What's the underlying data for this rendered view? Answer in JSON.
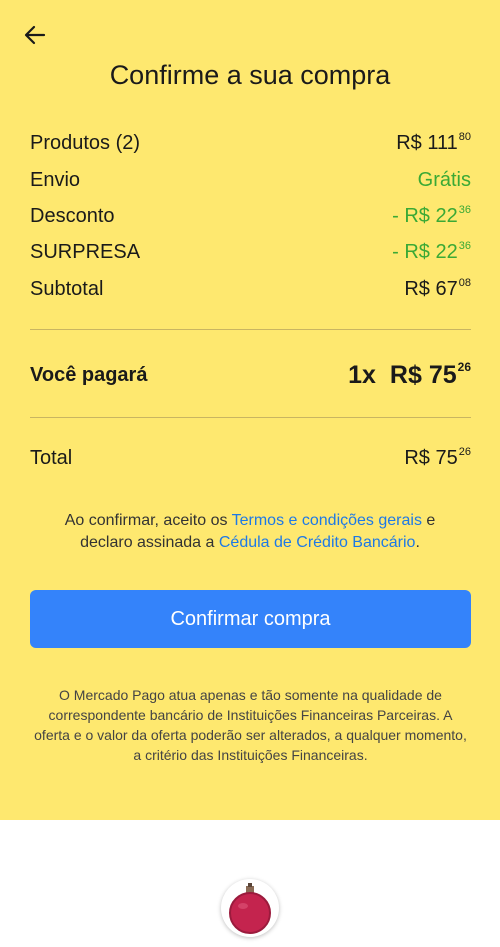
{
  "header": {
    "title": "Confirme a sua compra"
  },
  "summary": {
    "products": {
      "label": "Produtos (2)",
      "currency": "R$",
      "int": "111",
      "cents": "80"
    },
    "shipping": {
      "label": "Envio",
      "value": "Grátis"
    },
    "discount": {
      "label": "Desconto",
      "prefix": "- R$",
      "int": "22",
      "cents": "36"
    },
    "surprise": {
      "label": "SURPRESA",
      "prefix": "- R$",
      "int": "22",
      "cents": "36"
    },
    "subtotal": {
      "label": "Subtotal",
      "currency": "R$",
      "int": "67",
      "cents": "08"
    }
  },
  "payment": {
    "label": "Você pagará",
    "installments": "1x",
    "currency": "R$",
    "int": "75",
    "cents": "26"
  },
  "total": {
    "label": "Total",
    "currency": "R$",
    "int": "75",
    "cents": "26"
  },
  "terms": {
    "text1": "Ao confirmar, aceito os ",
    "link1": "Termos e condições gerais",
    "text2": " e declaro assinada a ",
    "link2": "Cédula de Crédito Bancário",
    "text3": "."
  },
  "confirm_button": {
    "label": "Confirmar compra"
  },
  "disclaimer": "O Mercado Pago atua apenas e tão somente na qualidade de correspondente bancário de Instituições Financeiras Parceiras. A oferta e o valor da oferta poderão ser alterados, a qualquer momento, a critério das Instituições Financeiras.",
  "icons": {
    "back": "arrow-left-icon",
    "product": "perfume-bottle-icon"
  },
  "colors": {
    "background": "#fee86f",
    "accent": "#3483fa",
    "link": "#1e79e6",
    "discount": "#3aa935"
  }
}
